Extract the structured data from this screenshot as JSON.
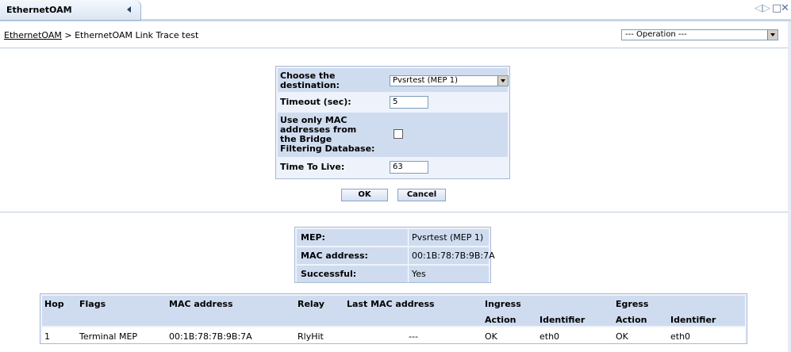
{
  "tab": {
    "title": "EthernetOAM"
  },
  "window_controls": {
    "prev": "◁",
    "next": "▷",
    "restore": "□",
    "close": "✕"
  },
  "breadcrumb": {
    "root": "EthernetOAM",
    "separator": " > ",
    "current": "EthernetOAM Link Trace test"
  },
  "operation_select": {
    "value": "--- Operation ---"
  },
  "form": {
    "destination": {
      "label": "Choose the destination:",
      "value": "Pvsrtest (MEP 1)"
    },
    "timeout": {
      "label": "Timeout (sec):",
      "value": "5"
    },
    "mac_only": {
      "label": "Use only MAC addresses from the Bridge Filtering Database:",
      "checked": false
    },
    "ttl": {
      "label": "Time To Live:",
      "value": "63"
    },
    "ok_label": "OK",
    "cancel_label": "Cancel"
  },
  "mep_info": {
    "rows": [
      {
        "key": "MEP:",
        "value": "Pvsrtest (MEP 1)"
      },
      {
        "key": "MAC address:",
        "value": "00:1B:78:7B:9B:7A"
      },
      {
        "key": "Successful:",
        "value": "Yes"
      }
    ]
  },
  "hop_table": {
    "headers": {
      "hop": "Hop",
      "flags": "Flags",
      "mac": "MAC address",
      "relay": "Relay",
      "last_mac": "Last MAC address",
      "ingress": "Ingress",
      "egress": "Egress",
      "ingress_action": "Action",
      "ingress_identifier": "Identifier",
      "egress_action": "Action",
      "egress_identifier": "Identifier"
    },
    "rows": [
      {
        "hop": "1",
        "flags": "Terminal MEP",
        "mac": "00:1B:78:7B:9B:7A",
        "relay": "RlyHit",
        "last_mac": "---",
        "ingress_action": "OK",
        "ingress_identifier": "eth0",
        "egress_action": "OK",
        "egress_identifier": "eth0"
      }
    ]
  }
}
